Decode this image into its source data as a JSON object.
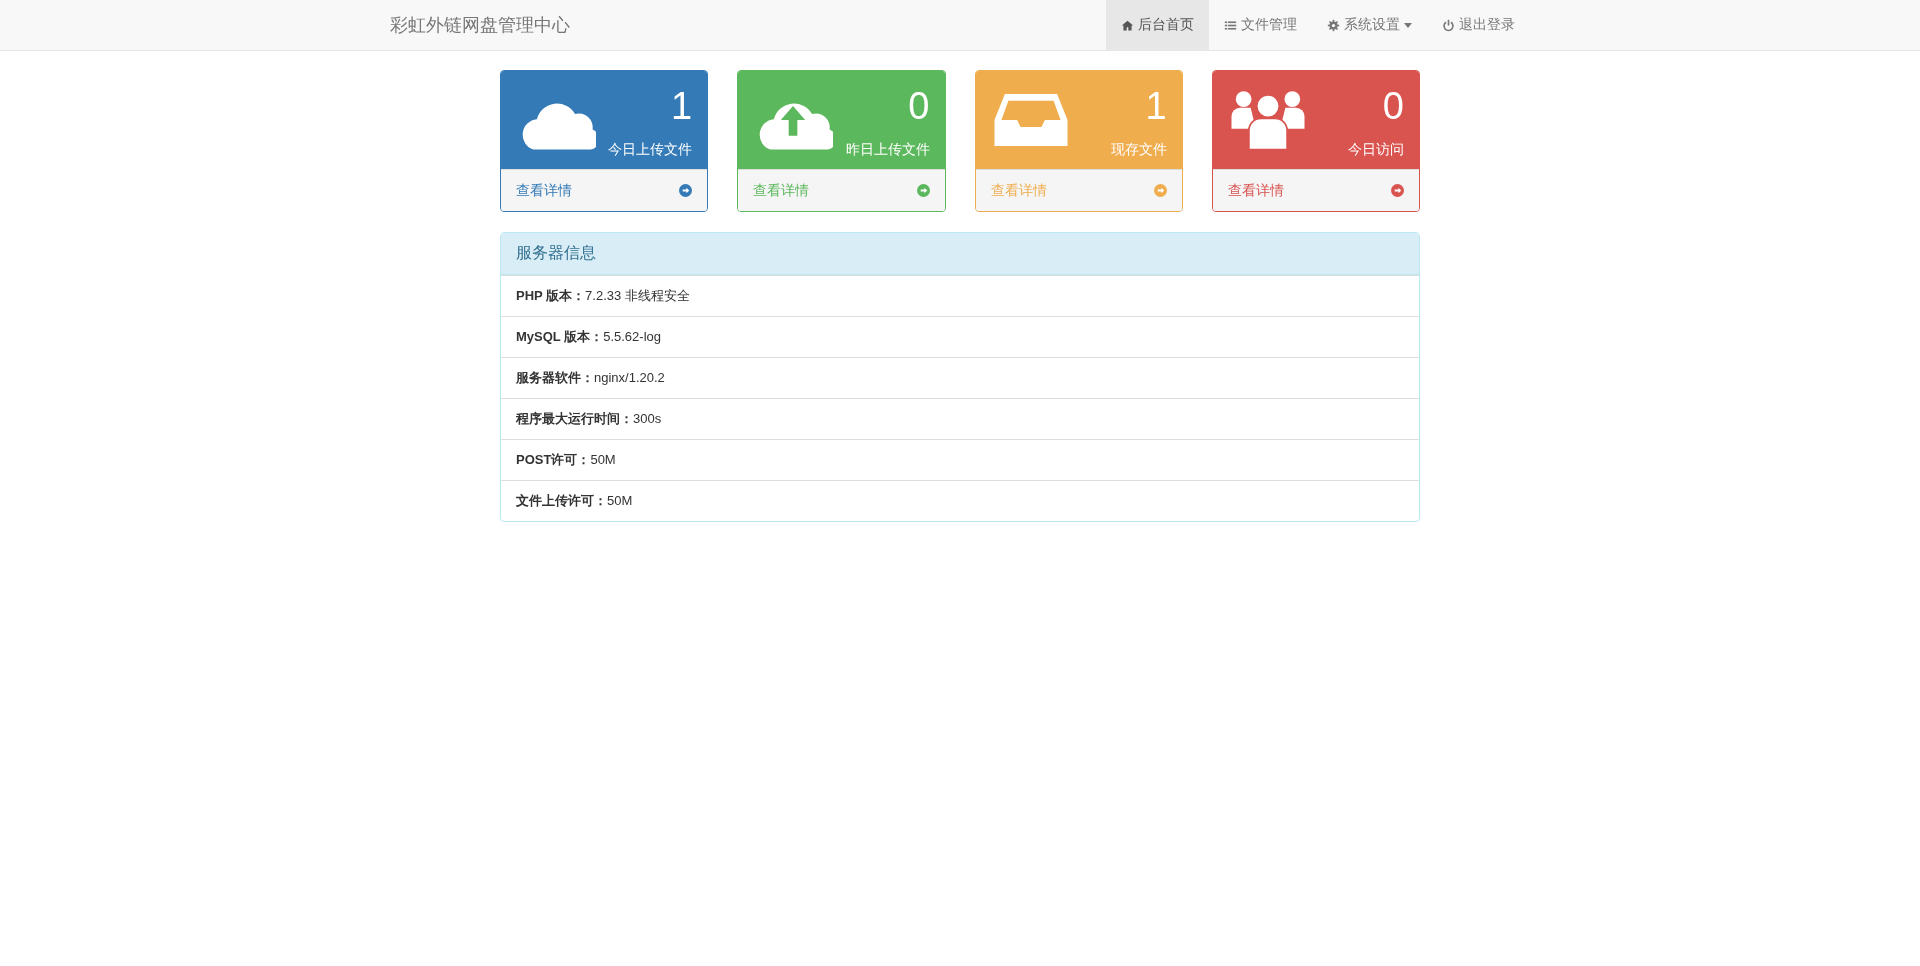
{
  "navbar": {
    "brand": "彩虹外链网盘管理中心",
    "items": [
      {
        "label": "后台首页",
        "kind": "home",
        "selected": true,
        "dropdown": false
      },
      {
        "label": "文件管理",
        "kind": "list",
        "selected": false,
        "dropdown": false
      },
      {
        "label": "系统设置",
        "kind": "gear",
        "selected": false,
        "dropdown": true
      },
      {
        "label": "退出登录",
        "kind": "power",
        "selected": false,
        "dropdown": false
      }
    ]
  },
  "stat_cards": [
    {
      "kind": "cloud",
      "color": "#337ab7",
      "count": "1",
      "label": "今日上传文件",
      "link": "查看详情"
    },
    {
      "kind": "upload",
      "color": "#5cb85c",
      "count": "0",
      "label": "昨日上传文件",
      "link": "查看详情"
    },
    {
      "kind": "inbox",
      "color": "#f0ad4e",
      "count": "1",
      "label": "现存文件",
      "link": "查看详情"
    },
    {
      "kind": "users",
      "color": "#d9534f",
      "count": "0",
      "label": "今日访问",
      "link": "查看详情"
    }
  ],
  "server_panel": {
    "title": "服务器信息",
    "rows": [
      "**PHP 版本：**7.2.33 非线程安全",
      "**MySQL 版本：**5.5.62-log",
      "**服务器软件：**nginx/1.20.2",
      "**程序最大运行时间：**300s",
      "**POST许可：**50M",
      "**文件上传许可：**50M"
    ]
  }
}
